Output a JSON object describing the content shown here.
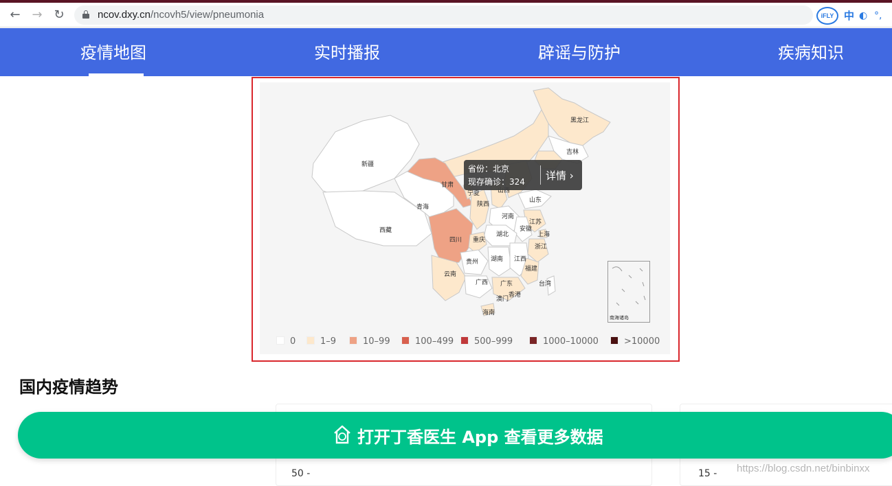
{
  "browser": {
    "url_host": "ncov.dxy.cn",
    "url_path": "/ncovh5/view/pneumonia",
    "ext_ifly": "iFLY",
    "ext_zhong": "中",
    "ext_moon": "◐",
    "ext_dots": "°,"
  },
  "nav": {
    "tabs": [
      {
        "label": "疫情地图",
        "active": true
      },
      {
        "label": "实时播报"
      },
      {
        "label": "辟谣与防护"
      },
      {
        "label": "疾病知识"
      }
    ]
  },
  "map": {
    "provinces": {
      "heilongjiang": "黑龙江",
      "jilin": "吉林",
      "xinjiang": "新疆",
      "gansu": "甘肃",
      "ningxia": "宁夏",
      "shanxi": "山西",
      "shandong": "山东",
      "qinghai": "青海",
      "shaanxi": "陕西",
      "henan": "河南",
      "jiangsu": "江苏",
      "anhui": "安徽",
      "xizang": "西藏",
      "hubei": "湖北",
      "shanghai": "上海",
      "sichuan": "四川",
      "chongqing": "重庆",
      "zhejiang": "浙江",
      "guizhou": "贵州",
      "hunan": "湖南",
      "jiangxi": "江西",
      "fujian": "福建",
      "yunnan": "云南",
      "guangxi": "广西",
      "guangdong": "广东",
      "taiwan": "台湾",
      "hongkong": "香港",
      "macau": "澳门",
      "hainan": "海南"
    },
    "tooltip": {
      "line1": "省份：北京",
      "line2": "现存确诊：324",
      "detail": "详情 ›"
    },
    "inset_caption": "南海诸岛",
    "legend": [
      {
        "label": "0",
        "color": "#ffffff"
      },
      {
        "label": "1–9",
        "color": "#fde8cc"
      },
      {
        "label": "10–99",
        "color": "#eea285"
      },
      {
        "label": "100–499",
        "color": "#d8604e"
      },
      {
        "label": "500–999",
        "color": "#c0393a"
      },
      {
        "label": "1000–10000",
        "color": "#7a2526"
      },
      {
        "label": ">10000",
        "color": "#4a1111"
      }
    ]
  },
  "trend": {
    "title": "国内疫情趋势",
    "axis_left": "50 -",
    "axis_right": "15 -"
  },
  "cta": {
    "label": "打开丁香医生 App 查看更多数据"
  },
  "watermark": "https://blog.csdn.net/binbinxx"
}
